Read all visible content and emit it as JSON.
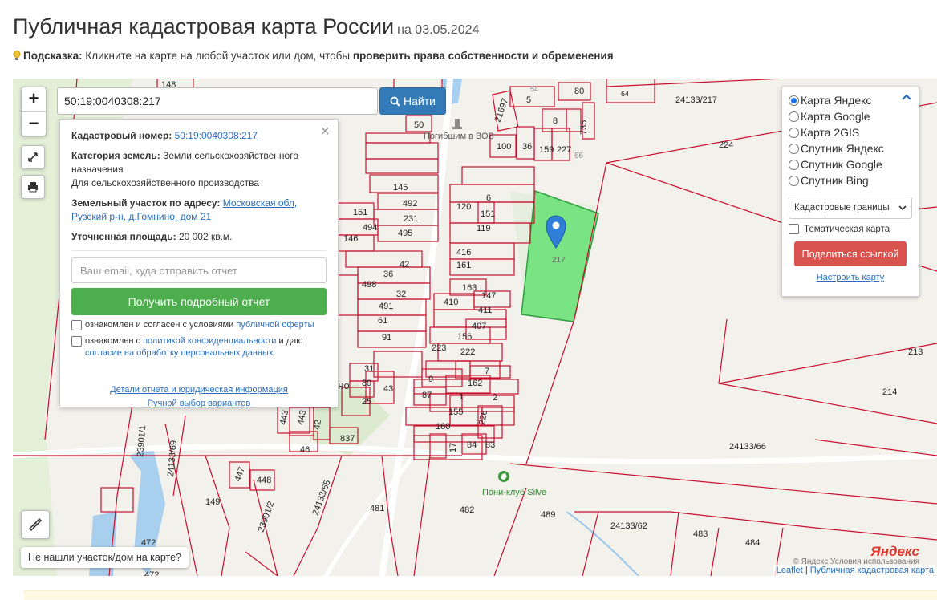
{
  "header": {
    "title": "Публичная кадастровая карта России",
    "date": "на 03.05.2024"
  },
  "hint": {
    "label": "Подсказка:",
    "text": "Кликните на карте на любой участок или дом, чтобы",
    "bold": "проверить права собственности и обременения",
    "end": "."
  },
  "map_controls": {
    "zoom_in": "+",
    "zoom_out": "−",
    "search_value": "50:19:0040308:217",
    "search_button": "Найти"
  },
  "info_panel": {
    "cadastral_label": "Кадастровый номер:",
    "cadastral_value": "50:19:0040308:217",
    "category_label": "Категория земель:",
    "category_value": "Земли сельскохозяйственного назначения",
    "usage_value": "Для сельскохозяйственного производства",
    "address_label": "Земельный участок по адресу:",
    "address_value": "Московская обл, Рузский р-н, д.Гомнино, дом 21",
    "area_label": "Уточненная площадь:",
    "area_value": "20 002 кв.м.",
    "email_placeholder": "Ваш email, куда отправить отчет",
    "report_button": "Получить подробный отчет",
    "consent1_text": "ознакомлен и согласен с условиями",
    "consent1_link": "публичной оферты",
    "consent2_text": "ознакомлен с",
    "consent2_link": "политикой конфиденциальности",
    "consent2_mid": "и даю",
    "consent2_link2": "согласие на обработку персональных данных",
    "details_link": "Детали отчета и юридическая информация",
    "manual_link": "Ручной выбор вариантов"
  },
  "layers_panel": {
    "options": [
      "Карта Яндекс",
      "Карта Google",
      "Карта 2GIS",
      "Спутник Яндекс",
      "Спутник Google",
      "Спутник Bing"
    ],
    "selected": "Карта Яндекс",
    "select_value": "Кадастровые границы",
    "thematic": "Тематическая карта",
    "share_button": "Поделиться ссылкой",
    "setup_link": "Настроить карту"
  },
  "map_labels": {
    "parcels": [
      "148",
      "50",
      "80",
      "54",
      "5",
      "64",
      "24133/217",
      "21697",
      "8",
      "735",
      "224",
      "100",
      "36",
      "159",
      "227",
      "66",
      "145",
      "6",
      "492",
      "120",
      "151",
      "231",
      "119",
      "151",
      "494",
      "495",
      "416",
      "146",
      "42",
      "161",
      "36",
      "498",
      "163",
      "147",
      "410",
      "411",
      "32",
      "491",
      "407",
      "61",
      "91",
      "156",
      "223",
      "222",
      "7",
      "31",
      "9",
      "162",
      "89",
      "43",
      "87",
      "1",
      "2",
      "25",
      "155",
      "226",
      "443",
      "443",
      "42",
      "160",
      "46",
      "837",
      "17",
      "84",
      "83",
      "24133/66",
      "213",
      "214",
      "23901/1",
      "24133/69",
      "447",
      "448",
      "149",
      "24133/65",
      "23901/2",
      "481",
      "482",
      "489",
      "24133/62",
      "483",
      "484",
      "472",
      "472",
      "217"
    ],
    "poi_memorial": "Погибшим в ВОВ",
    "poi_pony": "Пони-клуб Silve",
    "village_fragment": "ино"
  },
  "footer": {
    "not_found": "Не нашли участок/дом на карте?",
    "yandex_logo": "Яндекс",
    "attribution_leaflet": "Leaflet",
    "attribution_sep": "|",
    "attribution_link": "Публичная кадастровая карта",
    "copyright": "© Яндекс  Условия использования"
  },
  "colors": {
    "parcel_line": "#c8102e",
    "selected_parcel": "#6de27a",
    "primary": "#337ab7",
    "success": "#4cae4c",
    "danger": "#d9534f"
  }
}
